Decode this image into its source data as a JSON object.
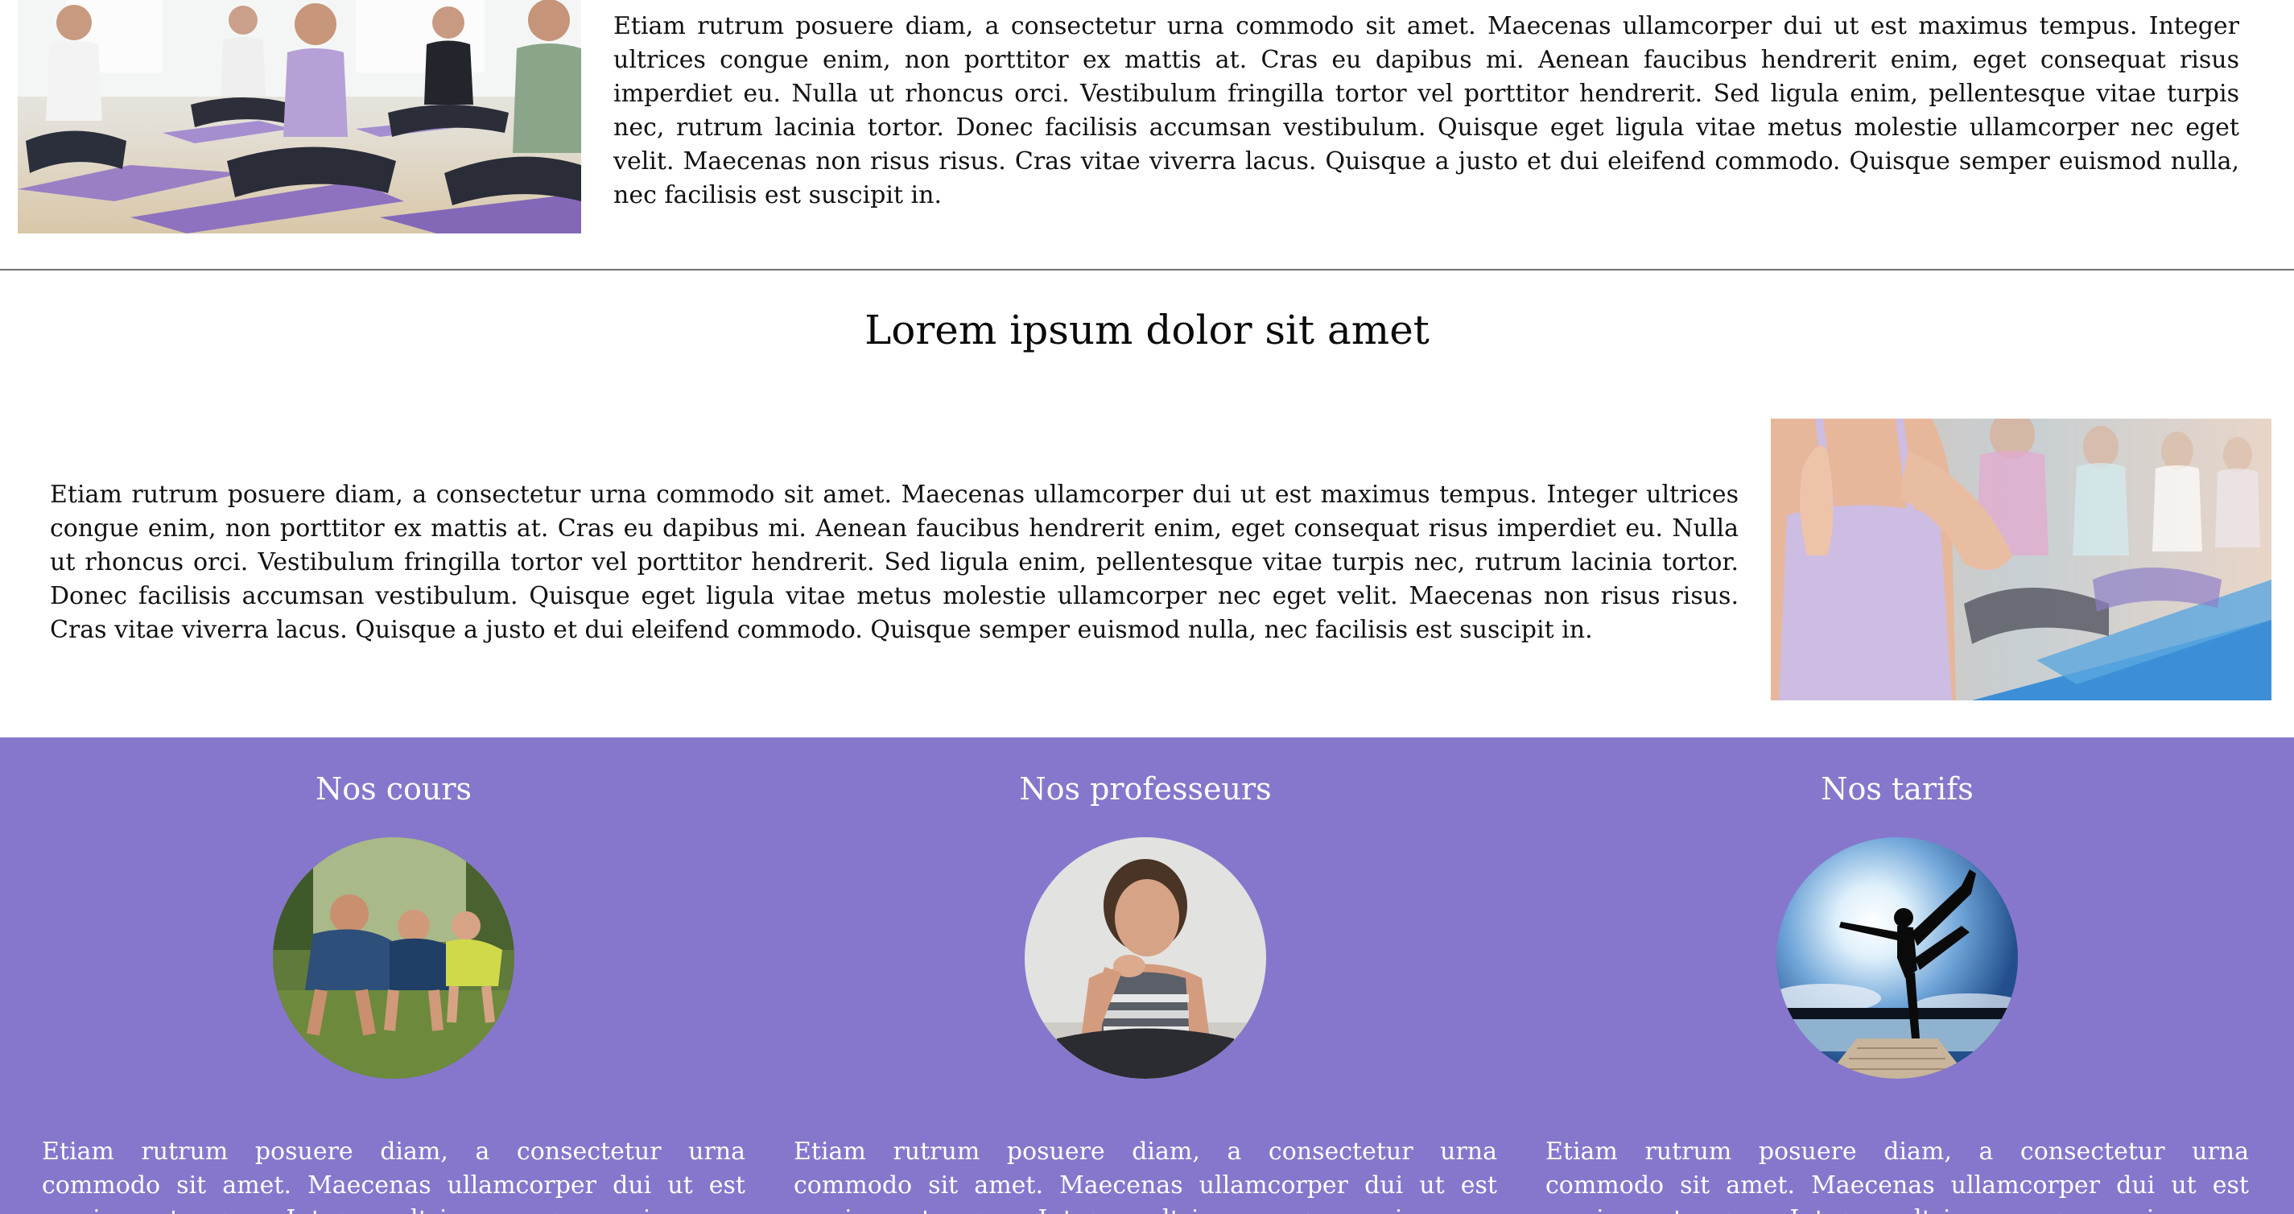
{
  "section_one": {
    "paragraph": "Etiam rutrum posuere diam, a consectetur urna commodo sit amet. Maecenas ullamcorper dui ut est maximus tempus. Integer ultrices congue enim, non porttitor ex mattis at. Cras eu dapibus mi. Aenean faucibus hendrerit enim, eget consequat risus imperdiet eu. Nulla ut rhoncus orci. Vestibulum fringilla tortor vel porttitor hendrerit. Sed ligula enim, pellentesque vitae turpis nec, rutrum lacinia tortor. Donec facilisis accumsan vestibulum. Quisque eget ligula vitae metus molestie ullamcorper nec eget velit. Maecenas non risus risus. Cras vitae viverra lacus. Quisque a justo et dui eleifend commodo. Quisque semper euismod nulla, nec facilisis est suscipit in."
  },
  "section_two": {
    "title": "Lorem ipsum dolor sit amet",
    "paragraph": "Etiam rutrum posuere diam, a consectetur urna commodo sit amet. Maecenas ullamcorper dui ut est maximus tempus. Integer ultrices congue enim, non porttitor ex mattis at. Cras eu dapibus mi. Aenean faucibus hendrerit enim, eget consequat risus imperdiet eu. Nulla ut rhoncus orci. Vestibulum fringilla tortor vel porttitor hendrerit. Sed ligula enim, pellentesque vitae turpis nec, rutrum lacinia tortor. Donec facilisis accumsan vestibulum. Quisque eget ligula vitae metus molestie ullamcorper nec eget velit. Maecenas non risus risus. Cras vitae viverra lacus. Quisque a justo et dui eleifend commodo. Quisque semper euismod nulla, nec facilisis est suscipit in."
  },
  "features": {
    "background_color": "#8677cd",
    "columns": [
      {
        "title": "Nos cours",
        "paragraph": "Etiam rutrum posuere diam, a consectetur urna commodo sit amet. Maecenas ullamcorper dui ut est maximus tempus. Integer ultrices congue enim, non porttitor ex mattis at."
      },
      {
        "title": "Nos professeurs",
        "paragraph": "Etiam rutrum posuere diam, a consectetur urna commodo sit amet. Maecenas ullamcorper dui ut est maximus tempus. Integer ultrices congue enim, non porttitor ex mattis at."
      },
      {
        "title": "Nos tarifs",
        "paragraph": "Etiam rutrum posuere diam, a consectetur urna commodo sit amet. Maecenas ullamcorper dui ut est maximus tempus. Integer ultrices congue enim, non porttitor ex mattis at."
      }
    ]
  }
}
